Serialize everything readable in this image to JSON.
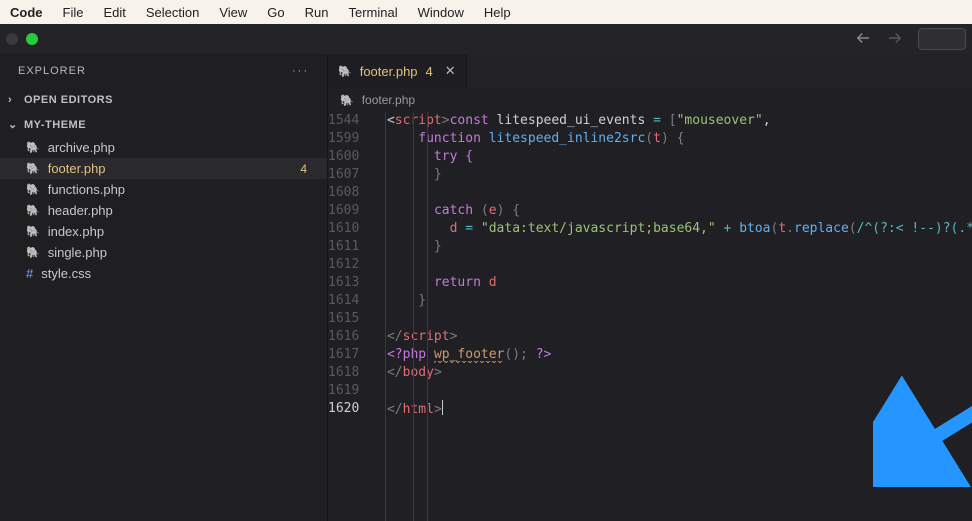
{
  "menubar": {
    "items": [
      "Code",
      "File",
      "Edit",
      "Selection",
      "View",
      "Go",
      "Run",
      "Terminal",
      "Window",
      "Help"
    ]
  },
  "sidebar": {
    "title": "EXPLORER",
    "open_editors_label": "OPEN EDITORS",
    "folder_name": "MY-THEME",
    "files": [
      {
        "name": "archive.php",
        "icon": "php"
      },
      {
        "name": "footer.php",
        "icon": "php",
        "active": true,
        "badge": "4"
      },
      {
        "name": "functions.php",
        "icon": "php"
      },
      {
        "name": "header.php",
        "icon": "php"
      },
      {
        "name": "index.php",
        "icon": "php"
      },
      {
        "name": "single.php",
        "icon": "php"
      },
      {
        "name": "style.css",
        "icon": "css"
      }
    ]
  },
  "tab": {
    "file": "footer.php",
    "badge": "4"
  },
  "breadcrumb": {
    "file": "footer.php"
  },
  "lines": {
    "nums": [
      "1544",
      "1599",
      "1600",
      "1607",
      "1608",
      "1609",
      "1610",
      "1611",
      "1612",
      "1613",
      "1614",
      "1615",
      "1616",
      "1617",
      "1618",
      "1619",
      "1620"
    ],
    "current_index": 16
  },
  "code": {
    "l0_pre": "  <",
    "l0_tag": "script",
    "l0_gt": ">",
    "l0_const": "const",
    "l0_name": " litespeed_ui_events ",
    "l0_eq": "=",
    "l0_arr_open": " [",
    "l0_str": "\"mouseover\"",
    "l0_comma": ",",
    "l1_pre": "      ",
    "l1_kw": "function",
    "l1_fn": " litespeed_inline2src",
    "l1_paren_o": "(",
    "l1_arg": "t",
    "l1_paren_c": ") {",
    "l2": "        try {",
    "l3": "        }",
    "l4": "",
    "l5_pre": "        ",
    "l5_kw": "catch",
    "l5_rest": " (",
    "l5_e": "e",
    "l5_rest2": ") {",
    "l6_pre": "          ",
    "l6_d": "d",
    "l6_sp": " ",
    "l6_eq": "=",
    "l6_sp2": " ",
    "l6_str": "\"data:text/javascript;base64,\"",
    "l6_plus": " + ",
    "l6_btoa": "btoa",
    "l6_p1": "(",
    "l6_t": "t",
    "l6_dot": ".",
    "l6_repl": "replace",
    "l6_p2": "(",
    "l6_regex": "/^(?:< !--)?(.*",
    "l7": "        }",
    "l8": "",
    "l9_pre": "        ",
    "l9_kw": "return",
    "l9_sp": " ",
    "l9_d": "d",
    "l10": "      }",
    "l11": "",
    "l12_pre": "  </",
    "l12_tag": "script",
    "l12_gt": ">",
    "l13_pre": "  ",
    "l13_php_o": "<?php",
    "l13_sp": " ",
    "l13_fn": "wp_footer",
    "l13_call": "();",
    "l13_sp2": " ",
    "l13_php_c": "?>",
    "l14_pre": "  </",
    "l14_tag": "body",
    "l14_gt": ">",
    "l15": "",
    "l16_pre": "  </",
    "l16_tag": "html",
    "l16_gt": ">"
  }
}
